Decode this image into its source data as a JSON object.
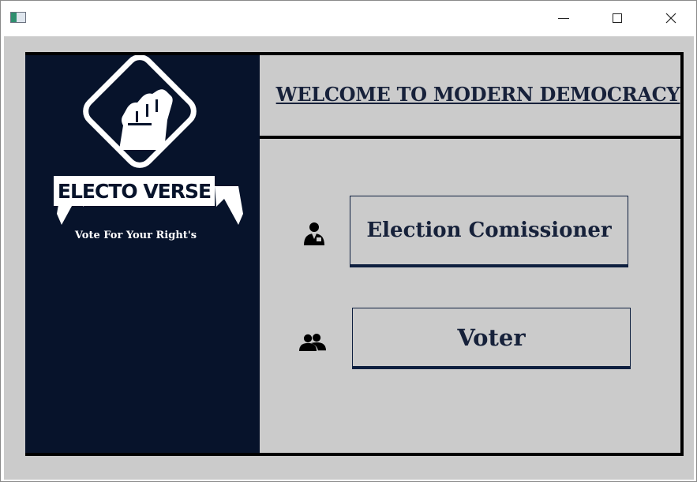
{
  "window": {
    "app_icon": "app-window-icon",
    "controls": {
      "minimize": "minimize-icon",
      "maximize": "maximize-icon",
      "close": "close-icon"
    }
  },
  "header": {
    "welcome_text": "WELCOME TO MODERN DEMOCRACY"
  },
  "brand": {
    "name": "ELECTO VERSE",
    "tagline": "Vote For Your  Right's",
    "logo_icon": "raised-fist-icon"
  },
  "roles": [
    {
      "label": "Election Comissioner",
      "icon": "official-person-icon"
    },
    {
      "label": "Voter",
      "icon": "people-group-icon"
    }
  ],
  "colors": {
    "left_panel": "#07132b",
    "background": "#cbcbcb",
    "button_border": "#0e1f3f"
  }
}
